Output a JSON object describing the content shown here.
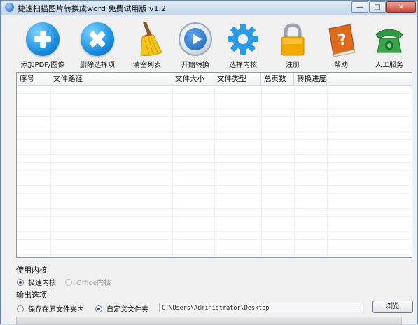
{
  "window": {
    "title": "捷速扫描图片转换成word 免费试用版 v1.2"
  },
  "toolbar": {
    "buttons": [
      {
        "label": "添加PDF/图像",
        "icon": "add-icon"
      },
      {
        "label": "删除选择项",
        "icon": "delete-icon"
      },
      {
        "label": "清空列表",
        "icon": "broom-icon"
      },
      {
        "label": "开始转换",
        "icon": "play-icon"
      },
      {
        "label": "选择内核",
        "icon": "gear-icon"
      },
      {
        "label": "注册",
        "icon": "lock-icon"
      },
      {
        "label": "帮助",
        "icon": "help-book-icon"
      },
      {
        "label": "人工服务",
        "icon": "phone-icon"
      }
    ]
  },
  "table": {
    "columns": [
      "序号",
      "文件路径",
      "文件大小",
      "文件类型",
      "总页数",
      "转换进度"
    ],
    "rows": []
  },
  "engine": {
    "title": "使用内核",
    "options": [
      {
        "label": "极速内核",
        "selected": true,
        "enabled": true
      },
      {
        "label": "Office内核",
        "selected": false,
        "enabled": false
      }
    ]
  },
  "output": {
    "title": "输出选项",
    "options": [
      {
        "label": "保存在原文件夹内",
        "selected": false
      },
      {
        "label": "自定义文件夹",
        "selected": true
      }
    ],
    "path_value": "C:\\Users\\Administrator\\Desktop",
    "browse_label": "浏览"
  },
  "colors": {
    "accent_blue": "#1b8fe0",
    "lock_gold": "#f0a800",
    "help_orange": "#e06a1a",
    "phone_green": "#2f9b3f"
  }
}
